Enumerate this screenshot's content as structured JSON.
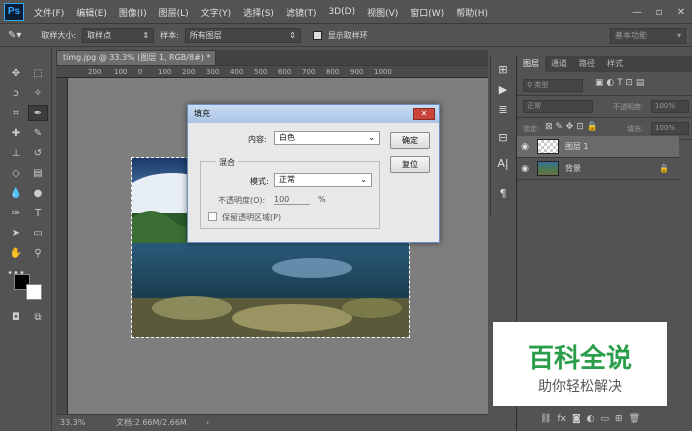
{
  "app": {
    "logo": "Ps"
  },
  "menu": [
    "文件(F)",
    "编辑(E)",
    "图像(I)",
    "图层(L)",
    "文字(Y)",
    "选择(S)",
    "滤镜(T)",
    "3D(D)",
    "视图(V)",
    "窗口(W)",
    "帮助(H)"
  ],
  "options": {
    "sample_size_label": "取样大小:",
    "sample_size_value": "取样点",
    "sample_label": "样本:",
    "sample_value": "所有图层",
    "show_ring_label": "显示取样环",
    "workspace": "基本功能"
  },
  "document": {
    "tab_title": "timg.jpg @ 33.3% (图层 1, RGB/8#) *",
    "zoom": "33.3%",
    "doc_size": "文档:2.66M/2.66M",
    "ruler_ticks": [
      "200",
      "100",
      "0",
      "100",
      "200",
      "300",
      "400",
      "500",
      "600",
      "700",
      "800",
      "900",
      "1000"
    ]
  },
  "layers_panel": {
    "tabs": [
      "图层",
      "通道",
      "路径",
      "样式"
    ],
    "kind_label": "类型",
    "blend_mode": "正常",
    "opacity_label": "不透明度:",
    "opacity_value": "100%",
    "lock_label": "锁定:",
    "fill_label": "填充:",
    "fill_value": "100%",
    "layers": [
      {
        "name": "图层 1"
      },
      {
        "name": "背景"
      }
    ]
  },
  "dialog": {
    "title": "填充",
    "content_label": "内容:",
    "content_value": "白色",
    "ok_label": "确定",
    "reset_label": "复位",
    "blend_group_label": "混合",
    "mode_label": "模式:",
    "mode_value": "正常",
    "opacity_label": "不透明度(O):",
    "opacity_value": "100",
    "opacity_unit": "%",
    "preserve_label": "保留透明区域(P)"
  },
  "watermark": {
    "title": "百科全说",
    "subtitle": "助你轻松解决"
  }
}
